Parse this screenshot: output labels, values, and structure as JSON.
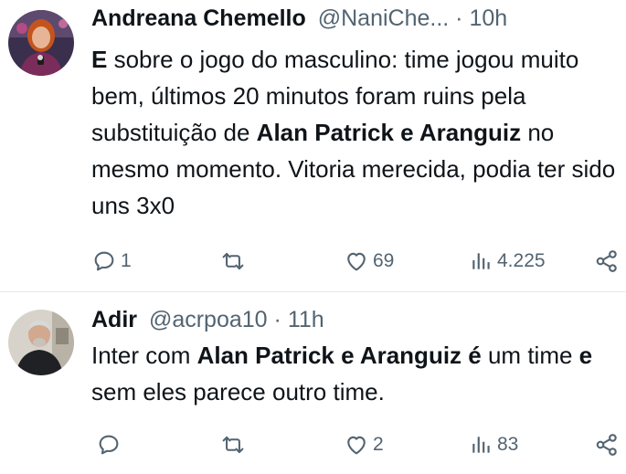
{
  "tweets": [
    {
      "name": "Andreana Chemello",
      "handle": "@NaniChe...",
      "sep": " · ",
      "time": "10h",
      "body": [
        {
          "t": "E",
          "b": true
        },
        {
          "t": " sobre o jogo do masculino: time jogou muito bem, últimos 20 minutos foram ruins pela substituição de ",
          "b": false
        },
        {
          "t": "Alan Patrick e Aranguiz",
          "b": true
        },
        {
          "t": " no mesmo momento. Vitoria merecida, podia ter sido uns 3x0",
          "b": false
        }
      ],
      "replies": "1",
      "retweets": "",
      "likes": "69",
      "views": "4.225"
    },
    {
      "name": "Adir",
      "handle": "@acrpoa10",
      "sep": " · ",
      "time": "11h",
      "body": [
        {
          "t": "Inter com ",
          "b": false
        },
        {
          "t": "Alan Patrick e Aranguiz",
          "b": true
        },
        {
          "t": " ",
          "b": false
        },
        {
          "t": "é",
          "b": true
        },
        {
          "t": " um time ",
          "b": false
        },
        {
          "t": "e",
          "b": true
        },
        {
          "t": " sem eles parece outro time.",
          "b": false
        }
      ],
      "replies": "",
      "retweets": "",
      "likes": "2",
      "views": "83"
    }
  ],
  "icons": {
    "reply": "reply-icon",
    "retweet": "retweet-icon",
    "like": "like-heart-icon",
    "views": "views-bar-chart-icon",
    "share": "share-icon"
  },
  "colors": {
    "text": "#0f1419",
    "secondary": "#536471",
    "divider": "#e6e9ec"
  }
}
